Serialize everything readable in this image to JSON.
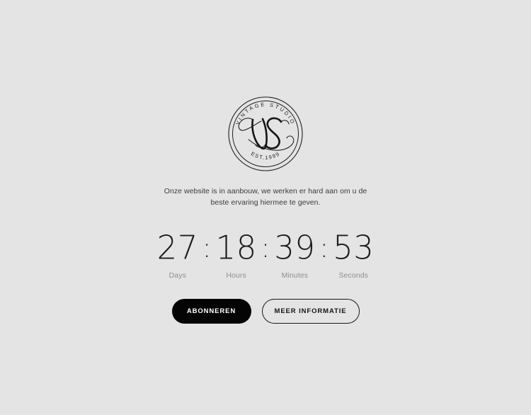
{
  "page": {
    "background_color": "#e5e4e4",
    "text_color": "#3b3b3b"
  },
  "logo": {
    "name": "vintage-studio-logo",
    "monogram": "VS",
    "arc_top_text": "VINTAGE STUDIO",
    "arc_bottom_text": "EST.1999",
    "stroke_color": "#1f1f1f"
  },
  "intro": {
    "text": "Onze website is in aanbouw, we werken er hard aan om u de beste ervaring hiermee te geven."
  },
  "countdown": {
    "separator": ":",
    "units": [
      {
        "value": "27",
        "label": "Days"
      },
      {
        "value": "18",
        "label": "Hours"
      },
      {
        "value": "39",
        "label": "Minutes"
      },
      {
        "value": "53",
        "label": "Seconds"
      }
    ]
  },
  "buttons": {
    "primary": {
      "label": "ABONNEREN",
      "background": "#040404",
      "color": "#ffffff"
    },
    "secondary": {
      "label": "MEER INFORMATIE",
      "border_color": "#181818",
      "color": "#151515"
    }
  }
}
